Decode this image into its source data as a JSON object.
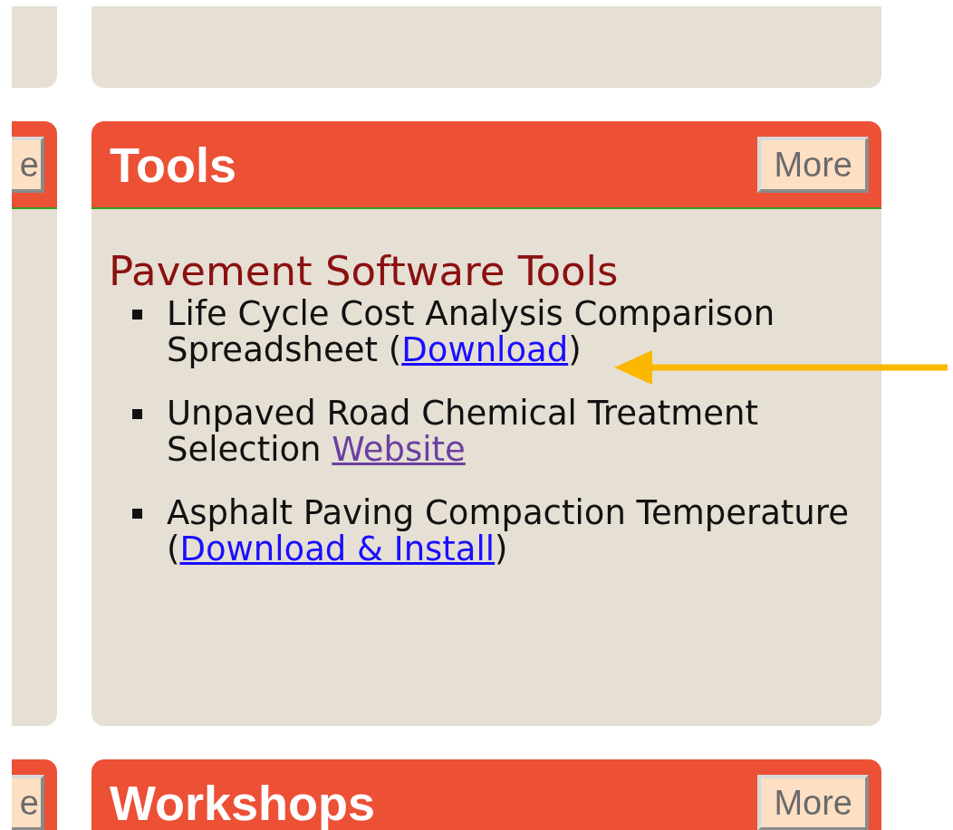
{
  "left_column": {
    "buttons": [
      "e",
      "e"
    ]
  },
  "panels": [
    {
      "kind": "empty"
    },
    {
      "kind": "section",
      "title": "Tools",
      "button": "More",
      "heading": "Pavement Software Tools",
      "items": [
        {
          "before": "Life Cycle Cost Analysis Comparison Spreadsheet (",
          "link": "Download",
          "visited": false,
          "after": ")"
        },
        {
          "before": "Unpaved Road Chemical Treatment Selection ",
          "link": "Website",
          "visited": true
        },
        {
          "before": "Asphalt Paving Compaction Temperature (",
          "link": "Download & Install",
          "visited": false,
          "after": ")"
        }
      ]
    },
    {
      "kind": "header",
      "title": "Workshops",
      "button": "More"
    }
  ],
  "annotation": {
    "kind": "arrow",
    "color": "#fbb800"
  }
}
